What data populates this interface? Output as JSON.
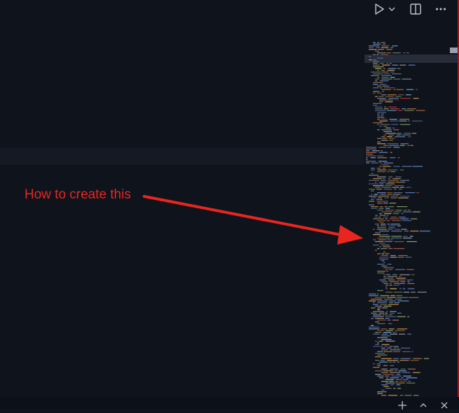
{
  "editor": {
    "toolbar": {
      "run_icon": "play-icon",
      "run_menu_icon": "chevron-down-icon",
      "split_icon": "split-editor-icon",
      "more_icon": "more-actions-icon"
    },
    "annotation": {
      "text": "How to create this",
      "color": "#e8261f"
    }
  },
  "panel": {
    "controls": [
      "add-icon",
      "maximize-icon",
      "close-icon"
    ]
  }
}
